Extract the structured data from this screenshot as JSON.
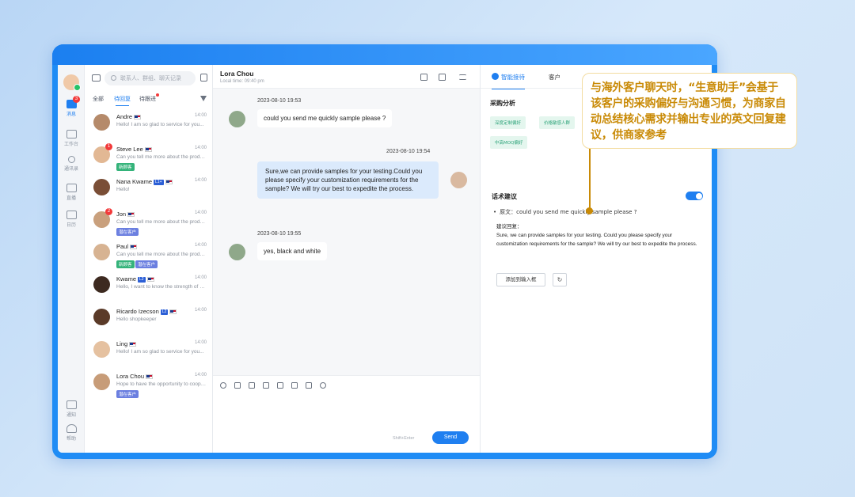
{
  "rail": {
    "items": [
      {
        "label": "消息",
        "badge": "3"
      },
      {
        "label": "工作台"
      },
      {
        "label": "通讯录"
      },
      {
        "label": "直播"
      },
      {
        "label": "日历"
      },
      {
        "label": "通知"
      },
      {
        "label": "帮助"
      }
    ]
  },
  "list": {
    "search_placeholder": "联系人、群组、聊天记录",
    "tabs": [
      "全部",
      "待回复",
      "待跟进"
    ],
    "conversations": [
      {
        "name": "Andre",
        "time": "14:00",
        "preview": "Hello! I am so glad to service for you...",
        "avatar": "#b58a6a"
      },
      {
        "name": "Steve Lee",
        "time": "14:00",
        "preview": "Can you tell me more about the product?",
        "tags": [
          "新顾客"
        ],
        "unread": "1",
        "avatar": "#e2b894"
      },
      {
        "name": "Nana Kwame",
        "level": "L1+",
        "time": "14:00",
        "preview": "Hello!",
        "avatar": "#7a4e36"
      },
      {
        "name": "Jon",
        "time": "14:00",
        "preview": "Can you tell me more about the product?",
        "tags": [
          "潜在客户"
        ],
        "unread": "2",
        "avatar": "#c9a07d"
      },
      {
        "name": "Paul",
        "time": "14:00",
        "preview": "Can you tell me more about the product?",
        "tags": [
          "新顾客",
          "潜在客户"
        ],
        "avatar": "#d7b392"
      },
      {
        "name": "Kwame",
        "level": "L2",
        "time": "14:00",
        "preview": "Hello, I want to know the strength of your company",
        "avatar": "#3d2a20"
      },
      {
        "name": "Ricardo Izecson",
        "level": "L2",
        "time": "14:00",
        "preview": "Hello shopkeeper",
        "avatar": "#5a3a28"
      },
      {
        "name": "Ling",
        "time": "14:00",
        "preview": "Hello! I am so glad to service for you...",
        "avatar": "#e5c1a0"
      },
      {
        "name": "Lora Chou",
        "time": "14:00",
        "preview": "Hope to have the opportunity to cooperate",
        "tags": [
          "潜在客户"
        ],
        "avatar": "#c79c78"
      }
    ]
  },
  "chat": {
    "contact_name": "Lora Chou",
    "local_time": "Local time: 09:40 pm",
    "messages": [
      {
        "time": "2023-08-10 19:53",
        "text": "could you send me quickly sample please ?",
        "mine": false
      },
      {
        "time": "2023-08-10 19:54",
        "text": "Sure,we can provide samples for your testing.Could you please specify your customization requirements for the sample? We will try our best to expedite the process.",
        "mine": true
      },
      {
        "time": "2023-08-10 19:55",
        "text": "yes, black and white",
        "mine": false
      }
    ],
    "composer_hint": "Shift+Enter",
    "send_label": "Send"
  },
  "assistant": {
    "tabs": [
      "智能接待",
      "客户"
    ],
    "purchase_title": "采购分析",
    "chips": [
      "深度定制偏好",
      "价格敏感人群",
      "中高MOQ偏好"
    ],
    "script_title": "话术建议",
    "original_label": "原文：",
    "original_text": "could you send me quickly sample please ?",
    "reply_label": "建议回复：",
    "reply_text": "Sure, we can provide samples for your testing. Could you please specify your customization requirements for the sample? We will try our best to expedite the process.",
    "add_button": "添加到输入框",
    "refresh_icon": "refresh-icon",
    "toggle_on": true
  },
  "callout": {
    "text": "与海外客户聊天时，“生意助手”会基于该客户的采购偏好与沟通习惯，为商家自动总结核心需求并输出专业的英文回复建议，供商家参考"
  },
  "colors": {
    "accent": "#1f7ff0",
    "callout_text": "#c98a06"
  }
}
